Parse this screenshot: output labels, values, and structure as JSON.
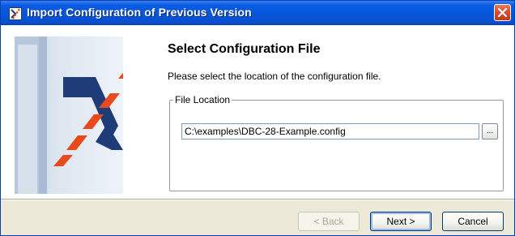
{
  "window": {
    "title": "Import Configuration of Previous Version",
    "app_icon": "vector-x-logo-icon",
    "close_icon": "close-icon"
  },
  "colors": {
    "titlebar": "#0654d8",
    "accent_red": "#e8491d",
    "accent_navy": "#1d3c78",
    "close_red": "#d94a2a"
  },
  "main": {
    "heading": "Select Configuration File",
    "description": "Please select the location of the configuration file.",
    "file_location": {
      "legend": "File Location",
      "path_value": "C:\\examples\\DBC-28-Example.config",
      "browse_label": "..."
    }
  },
  "footer": {
    "back_label": "< Back",
    "next_label": "Next >",
    "cancel_label": "Cancel"
  }
}
